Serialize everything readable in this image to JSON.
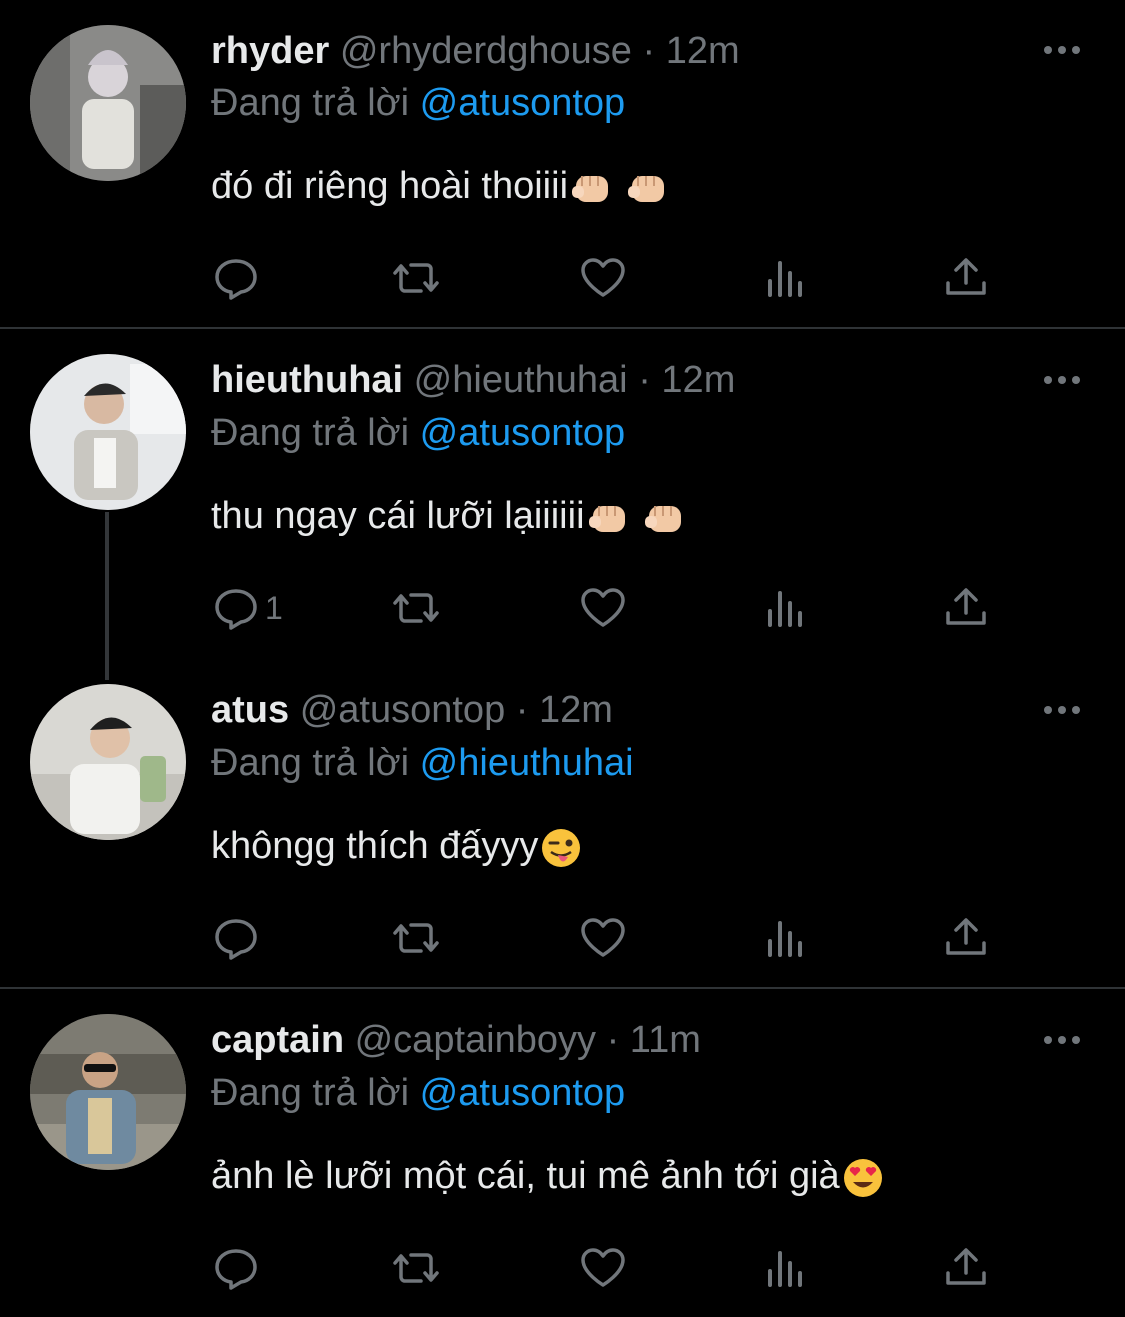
{
  "tweets": [
    {
      "name": "rhyder",
      "handle": "@rhyderdghouse",
      "dot": "·",
      "time": "12m",
      "reply_prefix": "Đang trả lời",
      "reply_to": "@atusontop",
      "text": "đó đi riêng hoài thoiiii",
      "emoji": [
        "fist-icon",
        "fist-icon"
      ],
      "reply_count": ""
    },
    {
      "name": "hieuthuhai",
      "handle": "@hieuthuhai",
      "dot": "·",
      "time": "12m",
      "reply_prefix": "Đang trả lời",
      "reply_to": "@atusontop",
      "text": "thu ngay cái lưỡi lạiiiiii",
      "emoji": [
        "fist-icon",
        "fist-icon"
      ],
      "reply_count": "1"
    },
    {
      "name": "atus",
      "handle": "@atusontop",
      "dot": "·",
      "time": "12m",
      "reply_prefix": "Đang trả lời",
      "reply_to": "@hieuthuhai",
      "text": "khôngg thích đấyyy",
      "emoji": [
        "winking-tongue-face-icon"
      ],
      "reply_count": ""
    },
    {
      "name": "captain",
      "handle": "@captainboyy",
      "dot": "·",
      "time": "11m",
      "reply_prefix": "Đang trả lời",
      "reply_to": "@atusontop",
      "text": "ảnh lè lưỡi một cái, tui mê ảnh tới già",
      "emoji": [
        "heart-eyes-face-icon"
      ],
      "reply_count": ""
    }
  ],
  "colors": {
    "background": "#000000",
    "primary_text": "#e7e9ea",
    "secondary_text": "#71767b",
    "mention": "#1d9bf0",
    "divider": "#2f3336"
  }
}
